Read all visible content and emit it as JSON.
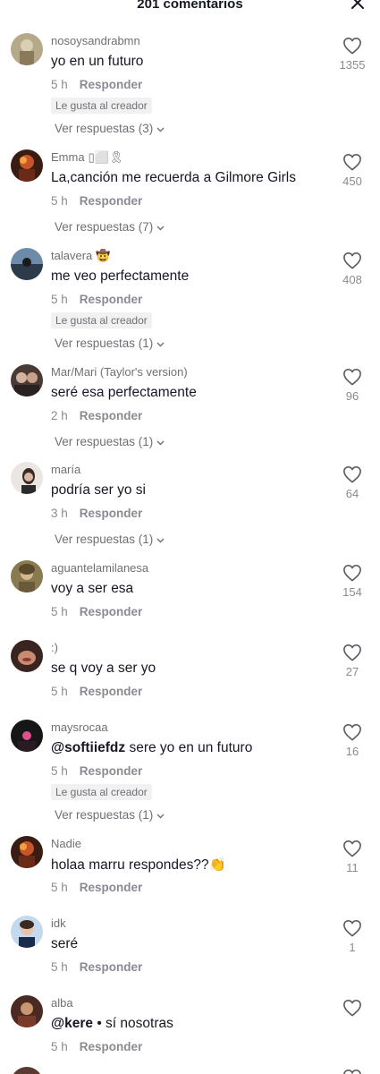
{
  "header": {
    "title": "201 comentarios"
  },
  "reply_label": "Responder",
  "creator_badge": "Le gusta al creador",
  "comments": [
    {
      "username": "nosoysandrabmn",
      "emoji": "",
      "text": "yo en un futuro",
      "mention": "",
      "time": "5 h",
      "likes": "1355",
      "creator_liked": true,
      "replies": "Ver respuestas (3)"
    },
    {
      "username": "Emma",
      "emoji": "▯⬜🎗",
      "text": "La,canción me recuerda a Gilmore Girls",
      "mention": "",
      "time": "5 h",
      "likes": "450",
      "creator_liked": false,
      "replies": "Ver respuestas (7)"
    },
    {
      "username": "talavera",
      "emoji": "🤠",
      "text": "me veo perfectamente",
      "mention": "",
      "time": "5 h",
      "likes": "408",
      "creator_liked": true,
      "replies": "Ver respuestas (1)"
    },
    {
      "username": "Mar/Mari (Taylor's version)",
      "emoji": "",
      "text": "seré esa perfectamente",
      "mention": "",
      "time": "2 h",
      "likes": "96",
      "creator_liked": false,
      "replies": "Ver respuestas (1)"
    },
    {
      "username": "maría",
      "emoji": "",
      "text": "podría ser yo si",
      "mention": "",
      "time": "3 h",
      "likes": "64",
      "creator_liked": false,
      "replies": "Ver respuestas (1)"
    },
    {
      "username": "aguantelamilanesa",
      "emoji": "",
      "text": "voy a ser esa",
      "mention": "",
      "time": "5 h",
      "likes": "154",
      "creator_liked": false,
      "replies": ""
    },
    {
      "username": ":)",
      "emoji": "",
      "text": "se q voy a ser yo",
      "mention": "",
      "time": "5 h",
      "likes": "27",
      "creator_liked": false,
      "replies": ""
    },
    {
      "username": "maysrocaa",
      "emoji": "",
      "text": "sere yo en un futuro",
      "mention": "@softiiefdz",
      "time": "5 h",
      "likes": "16",
      "creator_liked": true,
      "replies": "Ver respuestas (1)"
    },
    {
      "username": "Nadie",
      "emoji": "",
      "text": "holaa marru respondes??👏",
      "mention": "",
      "time": "5 h",
      "likes": "11",
      "creator_liked": false,
      "replies": ""
    },
    {
      "username": "idk",
      "emoji": "",
      "text": "seré",
      "mention": "",
      "time": "5 h",
      "likes": "1",
      "creator_liked": false,
      "replies": ""
    },
    {
      "username": "alba",
      "emoji": "",
      "text": "• sí nosotras",
      "mention": "@kere",
      "time": "5 h",
      "likes": "",
      "creator_liked": false,
      "replies": ""
    }
  ],
  "colors": {
    "text": "#161823",
    "secondary": "#8a8b91",
    "username": "#6f6f75",
    "badge_bg": "#f1f1f2"
  }
}
